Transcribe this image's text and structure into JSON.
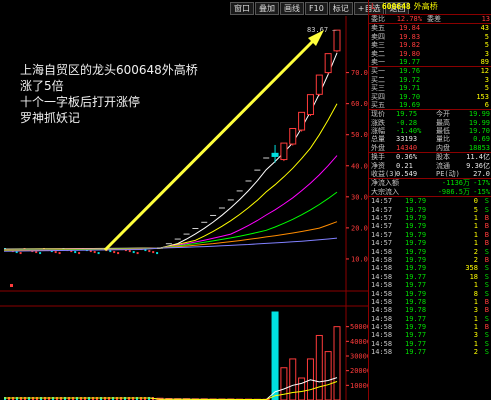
{
  "toolbar": [
    "窗口",
    "叠加",
    "画线",
    "F10",
    "标记",
    "+自选",
    "返回"
  ],
  "stock": {
    "flag": "L",
    "code": "600648",
    "name": "外高桥"
  },
  "annotation": {
    "lines": [
      "上海自贸区的龙头600648外高桥",
      "涨了5倍",
      "十个一字板后打开涨停",
      "罗神抓妖记"
    ]
  },
  "chart_data": [
    {
      "type": "candlestick",
      "title": "",
      "ylim": [
        0,
        85
      ],
      "y_ticks": [
        70,
        60,
        50,
        40,
        30,
        20,
        10
      ],
      "last_price_label": "83.67",
      "candles": [
        {
          "o": 13.5,
          "h": 13.5,
          "l": 13.5,
          "c": 13.5
        },
        {
          "o": 14.9,
          "h": 14.9,
          "l": 14.9,
          "c": 14.9
        },
        {
          "o": 16.4,
          "h": 16.4,
          "l": 16.4,
          "c": 16.4
        },
        {
          "o": 18.0,
          "h": 18.0,
          "l": 18.0,
          "c": 18.0
        },
        {
          "o": 19.8,
          "h": 19.8,
          "l": 19.8,
          "c": 19.8
        },
        {
          "o": 21.8,
          "h": 21.8,
          "l": 21.8,
          "c": 21.8
        },
        {
          "o": 24.0,
          "h": 24.0,
          "l": 24.0,
          "c": 24.0
        },
        {
          "o": 26.4,
          "h": 26.4,
          "l": 26.4,
          "c": 26.4
        },
        {
          "o": 29.0,
          "h": 29.0,
          "l": 29.0,
          "c": 29.0
        },
        {
          "o": 31.9,
          "h": 31.9,
          "l": 31.9,
          "c": 31.9
        },
        {
          "o": 35.1,
          "h": 35.1,
          "l": 35.1,
          "c": 35.1
        },
        {
          "o": 38.6,
          "h": 38.6,
          "l": 38.6,
          "c": 38.6
        },
        {
          "o": 42.5,
          "h": 42.5,
          "l": 42.5,
          "c": 42.5
        },
        {
          "o": 44.0,
          "h": 46.7,
          "l": 41.0,
          "c": 43.0
        },
        {
          "o": 42.0,
          "h": 47.3,
          "l": 41.5,
          "c": 47.3
        },
        {
          "o": 47.0,
          "h": 52.0,
          "l": 46.5,
          "c": 52.0
        },
        {
          "o": 51.5,
          "h": 57.2,
          "l": 51.0,
          "c": 57.2
        },
        {
          "o": 56.5,
          "h": 62.9,
          "l": 56.0,
          "c": 62.9
        },
        {
          "o": 63.0,
          "h": 69.2,
          "l": 62.5,
          "c": 69.2
        },
        {
          "o": 70.0,
          "h": 76.1,
          "l": 69.5,
          "c": 76.1
        },
        {
          "o": 77.0,
          "h": 83.67,
          "l": 76.5,
          "c": 83.67
        }
      ],
      "moving_averages": [
        {
          "name": "MA5",
          "color": "#ffffff"
        },
        {
          "name": "MA10",
          "color": "#ffff00"
        },
        {
          "name": "MA20",
          "color": "#ff00ff"
        },
        {
          "name": "MA30",
          "color": "#00ff00"
        },
        {
          "name": "MA60",
          "color": "#ff8c00"
        },
        {
          "name": "MA120",
          "color": "#8080ff"
        }
      ]
    },
    {
      "type": "bar",
      "title": "volume",
      "ylim": [
        0,
        60000
      ],
      "y_ticks": [
        50000,
        40000,
        30000,
        20000,
        10000
      ],
      "values": [
        1200,
        1000,
        900,
        900,
        800,
        800,
        700,
        700,
        700,
        600,
        600,
        500,
        500,
        60000,
        22000,
        28000,
        15000,
        28000,
        44000,
        33000,
        50000
      ]
    }
  ],
  "quote": {
    "weibi": {
      "label": "委比",
      "value": "12.78%",
      "label2": "委差",
      "value2": "13"
    },
    "asks": [
      {
        "label": "卖五",
        "price": "19.84",
        "vol": "43"
      },
      {
        "label": "卖四",
        "price": "19.83",
        "vol": "5"
      },
      {
        "label": "卖三",
        "price": "19.82",
        "vol": "5"
      },
      {
        "label": "卖二",
        "price": "19.80",
        "vol": "3"
      },
      {
        "label": "卖一",
        "price": "19.77",
        "vol": "89"
      }
    ],
    "bids": [
      {
        "label": "买一",
        "price": "19.76",
        "vol": "12"
      },
      {
        "label": "买二",
        "price": "19.72",
        "vol": "3"
      },
      {
        "label": "买三",
        "price": "19.71",
        "vol": "5"
      },
      {
        "label": "买四",
        "price": "19.70",
        "vol": "153"
      },
      {
        "label": "买五",
        "price": "19.69",
        "vol": "6"
      }
    ],
    "stats": [
      {
        "l1": "现价",
        "v1": "19.75",
        "l2": "今开",
        "v2": "19.99"
      },
      {
        "l1": "涨跌",
        "v1": "-0.28",
        "l2": "最高",
        "v2": "19.99"
      },
      {
        "l1": "涨幅",
        "v1": "-1.40%",
        "l2": "最低",
        "v2": "19.70"
      },
      {
        "l1": "总量",
        "v1": "33193",
        "l2": "量比",
        "v2": "0.69"
      },
      {
        "l1": "外盘",
        "v1": "14340",
        "l2": "内盘",
        "v2": "18853"
      }
    ],
    "stats2": [
      {
        "l1": "换手",
        "v1": "0.36%",
        "l2": "股本",
        "v2": "11.4亿"
      },
      {
        "l1": "净资",
        "v1": "0.21",
        "l2": "流通",
        "v2": "9.36亿"
      },
      {
        "l1": "收益(3)",
        "v1": "0.549",
        "l2": "PE(动)",
        "v2": "27.0"
      }
    ],
    "flows": [
      {
        "label": "净流入额",
        "value": "-1136万",
        "pct": "-17%"
      },
      {
        "label": "大宗流入",
        "value": "-986.5万",
        "pct": "-15%"
      }
    ]
  },
  "ticks": [
    {
      "t": "14:57",
      "p": "19.79",
      "v": "0",
      "d": "S"
    },
    {
      "t": "14:57",
      "p": "19.79",
      "v": "5",
      "d": "S"
    },
    {
      "t": "14:57",
      "p": "19.79",
      "v": "1",
      "d": "B"
    },
    {
      "t": "14:57",
      "p": "19.79",
      "v": "1",
      "d": "B"
    },
    {
      "t": "14:57",
      "p": "19.79",
      "v": "1",
      "d": "B"
    },
    {
      "t": "14:57",
      "p": "19.79",
      "v": "1",
      "d": "B"
    },
    {
      "t": "14:58",
      "p": "19.79",
      "v": "2",
      "d": "S"
    },
    {
      "t": "14:58",
      "p": "19.79",
      "v": "2",
      "d": "B"
    },
    {
      "t": "14:58",
      "p": "19.79",
      "v": "358",
      "d": "S"
    },
    {
      "t": "14:58",
      "p": "19.77",
      "v": "18",
      "d": "S"
    },
    {
      "t": "14:58",
      "p": "19.77",
      "v": "1",
      "d": "S"
    },
    {
      "t": "14:58",
      "p": "19.79",
      "v": "8",
      "d": "S"
    },
    {
      "t": "14:58",
      "p": "19.78",
      "v": "1",
      "d": "B"
    },
    {
      "t": "14:58",
      "p": "19.78",
      "v": "3",
      "d": "B"
    },
    {
      "t": "14:58",
      "p": "19.77",
      "v": "1",
      "d": "S"
    },
    {
      "t": "14:58",
      "p": "19.79",
      "v": "1",
      "d": "B"
    },
    {
      "t": "14:58",
      "p": "19.77",
      "v": "3",
      "d": "S"
    },
    {
      "t": "14:58",
      "p": "19.77",
      "v": "1",
      "d": "S"
    },
    {
      "t": "14:58",
      "p": "19.77",
      "v": "2",
      "d": "S"
    }
  ],
  "colors": {
    "up": "#ff3b3b",
    "down": "#00e0e0",
    "vol_bar": "#ff3b3b",
    "vol_spike": "#00e0e0",
    "arrow": "#ffff3b",
    "limit_dash": "#d0d0d0"
  }
}
